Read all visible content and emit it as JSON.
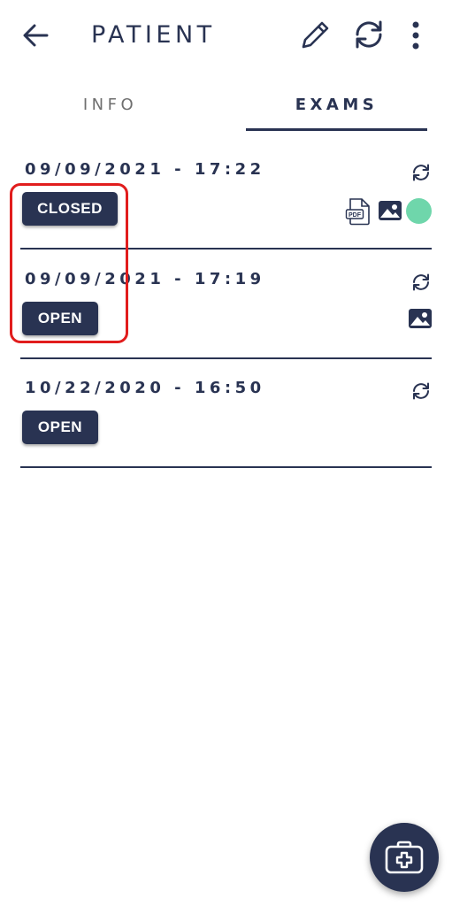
{
  "app_bar": {
    "title": "PATIENT",
    "icons": [
      "arrow-left-icon",
      "pencil-icon",
      "sync-icon",
      "more-vertical-icon"
    ]
  },
  "tabs": [
    {
      "label": "INFO",
      "selected": false
    },
    {
      "label": "EXAMS",
      "selected": true
    }
  ],
  "exams": [
    {
      "datetime": "09/09/2021 - 17:22",
      "status": "CLOSED",
      "has_pdf": true,
      "has_image": true,
      "dot_color": "#6fd6ab"
    },
    {
      "datetime": "09/09/2021 - 17:19",
      "status": "OPEN",
      "has_pdf": false,
      "has_image": true
    },
    {
      "datetime": "10/22/2020 - 16:50",
      "status": "OPEN",
      "has_pdf": false,
      "has_image": false
    }
  ],
  "pdf_icon_text": "PDF",
  "fab": {
    "icon": "medical-kit-icon"
  },
  "colors": {
    "primary": "#293352",
    "accent_dot": "#6fd6ab",
    "highlight": "#e11d1d"
  }
}
